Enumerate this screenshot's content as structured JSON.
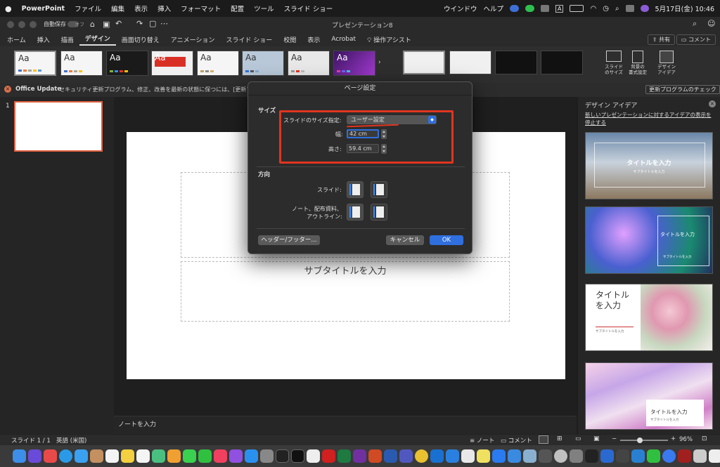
{
  "menubar": {
    "app": "PowerPoint",
    "items": [
      "ファイル",
      "編集",
      "表示",
      "挿入",
      "フォーマット",
      "配置",
      "ツール",
      "スライド ショー",
      "ウインドウ",
      "ヘルプ"
    ],
    "icon_a": "A",
    "datetime": "5月17日(金)  10:46"
  },
  "titlebar": {
    "autosave_label": "自動保存",
    "autosave_state": "オフ",
    "doc_title": "プレゼンテーション8"
  },
  "ribbon": {
    "tabs": [
      "ホーム",
      "挿入",
      "描画",
      "デザイン",
      "画面切り替え",
      "アニメーション",
      "スライド ショー",
      "校閲",
      "表示",
      "Acrobat"
    ],
    "active_tab": "デザイン",
    "assist": "操作アシスト",
    "share": "共有",
    "comment": "コメント",
    "theme_label": "Aa",
    "slide_size_label": "スライド\nのサイズ",
    "bg_format_label": "背景の\n書式設定",
    "design_ideas_label": "デザイン\nアイデア"
  },
  "updatebar": {
    "title": "Office Update",
    "message": "セキュリティ更新プログラム、修正、改善を最新の状態に保つには、[更新プロ",
    "button": "更新プログラムのチェック"
  },
  "slides_pane": {
    "slide_number": "1"
  },
  "slide": {
    "subtitle_placeholder": "サブタイトルを入力"
  },
  "notes": {
    "placeholder": "ノートを入力"
  },
  "design_pane": {
    "title": "デザイン アイデア",
    "link": "新しいプレゼンテーションに対するアイデアの表示を停止する",
    "idea1_title": "タイトルを入力",
    "idea1_sub": "サブタイトルを入力",
    "idea2_title": "タイトルを入力",
    "idea2_sub": "サブタイトルを入力",
    "idea3_title": "タイトルを入力",
    "idea3_sub": "サブタイトルを入力",
    "idea4_title": "タイトルを入力",
    "idea4_sub": "サブタイトルを入力"
  },
  "statusbar": {
    "slide_info": "スライド 1 / 1",
    "language": "英語 (米国)",
    "notes": "ノート",
    "comments": "コメント",
    "zoom": "96%"
  },
  "dialog": {
    "title": "ページ設定",
    "size_section": "サイズ",
    "slide_size_label": "スライドのサイズ指定:",
    "slide_size_value": "ユーザー設定",
    "width_label": "幅:",
    "width_value": "42 cm",
    "height_label": "高さ:",
    "height_value": "59.4 cm",
    "orientation_section": "方向",
    "slides_label": "スライド:",
    "notes_label": "ノート、配布資料、\nアウトライン:",
    "header_footer_button": "ヘッダー/フッター...",
    "cancel_button": "キャンセル",
    "ok_button": "OK"
  },
  "colors": {
    "accent": "#2f6fde",
    "highlight": "#e0351f",
    "dialog_bg": "#2c2c2c"
  }
}
